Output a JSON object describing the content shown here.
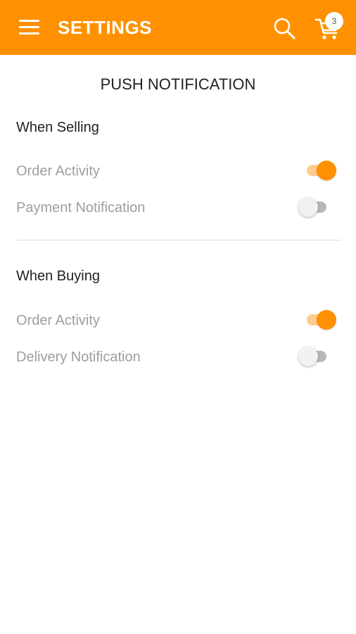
{
  "header": {
    "title": "SETTINGS",
    "cart_count": "3",
    "color": "#ff9100",
    "icons": [
      "menu-icon",
      "search-icon",
      "cart-icon"
    ]
  },
  "push": {
    "heading": "PUSH NOTIFICATION"
  },
  "selling": {
    "title": "When Selling",
    "items": [
      {
        "label": "Order Activity",
        "enabled": true
      },
      {
        "label": "Payment Notification",
        "enabled": false
      }
    ]
  },
  "buying": {
    "title": "When Buying",
    "items": [
      {
        "label": "Order Activity",
        "enabled": true
      },
      {
        "label": "Delivery Notification",
        "enabled": false
      }
    ]
  }
}
